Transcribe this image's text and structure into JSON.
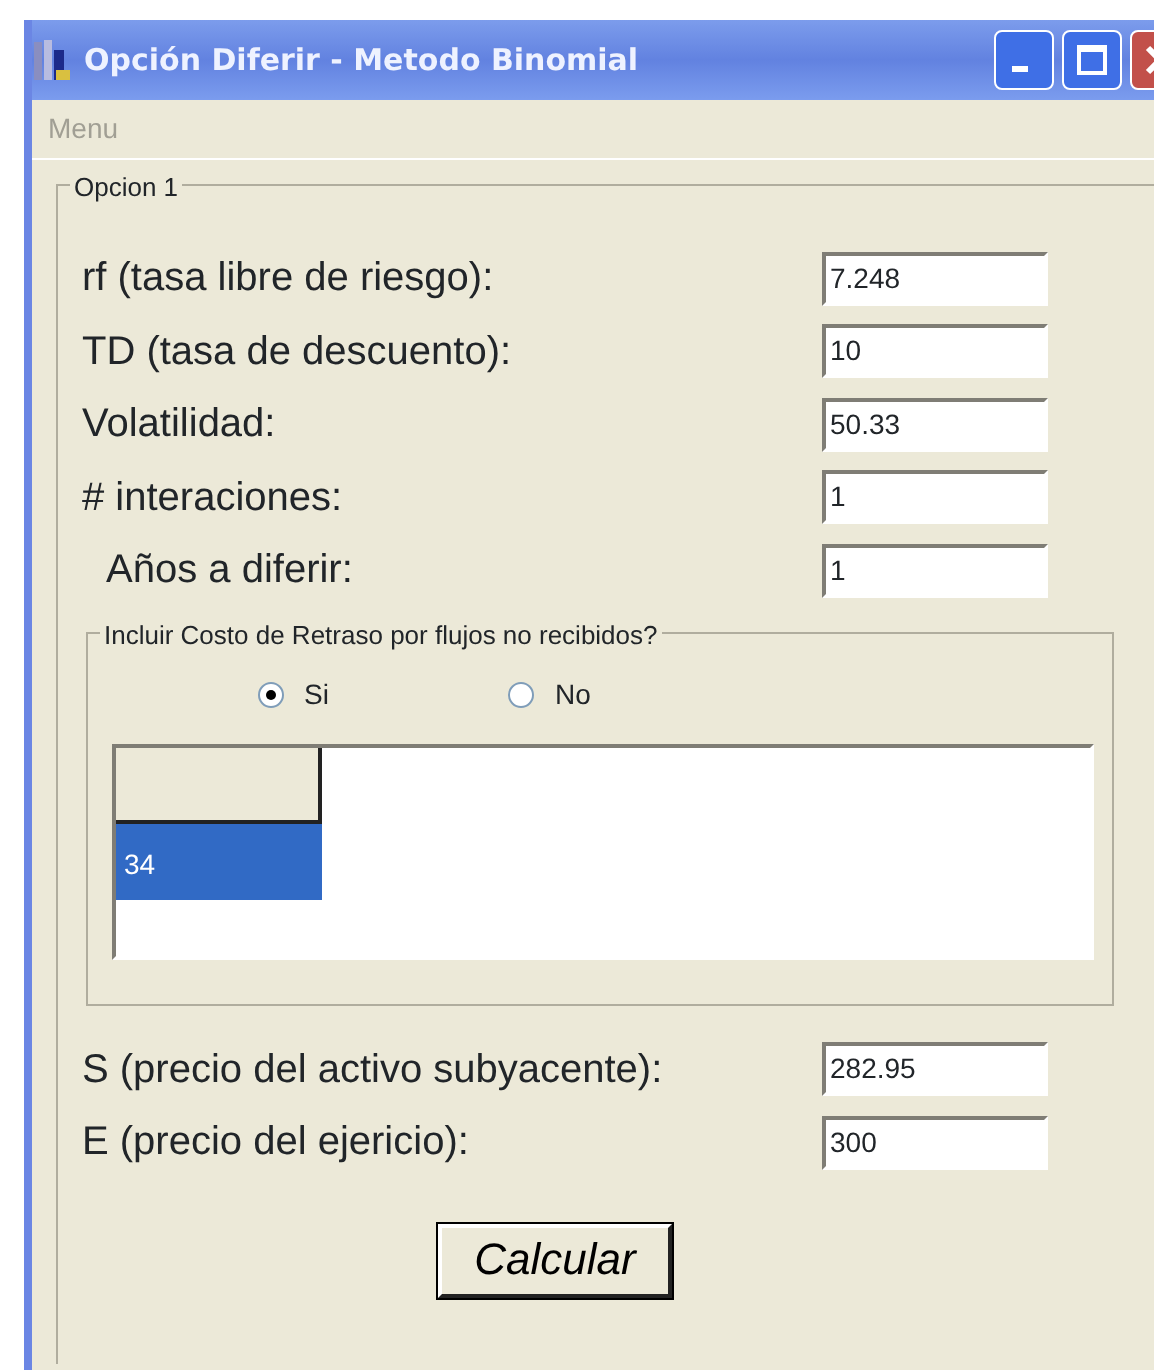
{
  "window": {
    "title": "Opción Diferir - Metodo Binomial"
  },
  "menu": [
    "Menu"
  ],
  "group": {
    "title": "Opcion 1",
    "fields_top": [
      {
        "label": "rf (tasa libre de riesgo):",
        "value": "7.248"
      },
      {
        "label": "TD (tasa de descuento):",
        "value": "10"
      },
      {
        "label": "Volatilidad:",
        "value": "50.33"
      },
      {
        "label": "# interaciones:",
        "value": "1"
      },
      {
        "label": "Años a diferir:",
        "value": "1",
        "indented": true
      }
    ],
    "delay_group": {
      "title": "Incluir Costo de Retraso por flujos no recibidos?",
      "options": [
        {
          "label": "Si",
          "selected": true
        },
        {
          "label": "No",
          "selected": false
        }
      ],
      "grid": {
        "rows": [
          {
            "value": "34",
            "selected": true
          }
        ]
      }
    },
    "fields_bottom": [
      {
        "label": "S (precio del activo subyacente):",
        "value": "282.95"
      },
      {
        "label": "E (precio del ejericio):",
        "value": "300"
      }
    ],
    "button": "Calcular"
  }
}
